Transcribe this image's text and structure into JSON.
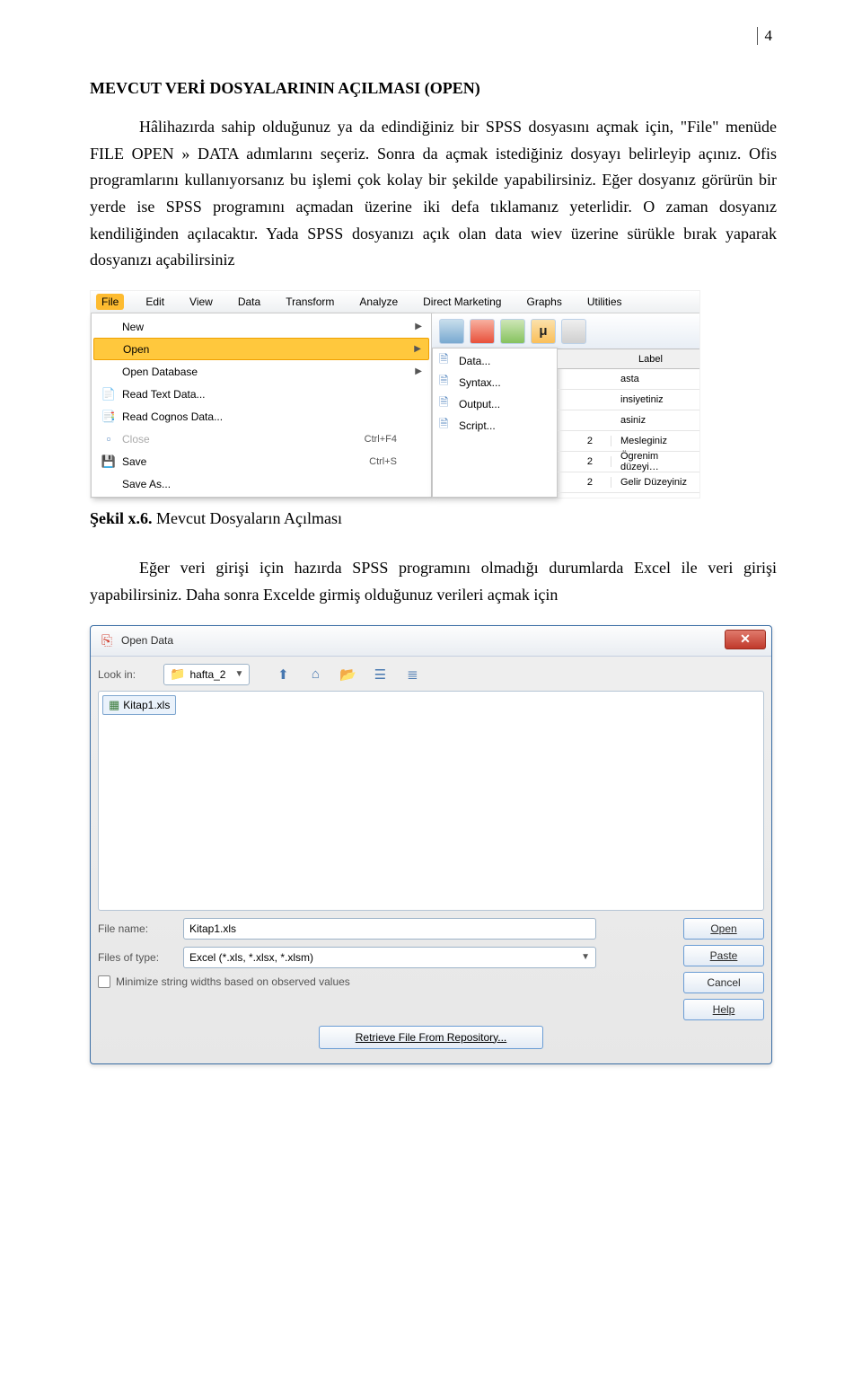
{
  "page_number": "4",
  "heading": "MEVCUT VERİ DOSYALARININ AÇILMASI (OPEN)",
  "para1": "Hâlihazırda sahip olduğunuz ya da edindiğiniz bir SPSS dosyasını açmak için, \"File\" menüde FILE OPEN » DATA adımlarını seçeriz. Sonra da açmak istediğiniz dosyayı belirleyip açınız. Ofis programlarını kullanıyorsanız bu işlemi çok kolay bir şekilde yapabilirsiniz. Eğer dosyanız görürün bir yerde ise SPSS programını açmadan üzerine iki defa tıklamanız yeterlidir. O zaman dosyanız kendiliğinden açılacaktır. Yada SPSS dosyanızı açık olan data wiev üzerine sürükle bırak yaparak dosyanızı açabilirsiniz",
  "caption": {
    "lead": "Şekil x.6.",
    "rest": " Mevcut Dosyaların Açılması"
  },
  "para2": "Eğer veri girişi için hazırda SPSS programını olmadığı durumlarda Excel ile veri girişi yapabilirsiniz. Daha sonra Excelde girmiş olduğunuz verileri açmak için",
  "spss": {
    "menubar": [
      "File",
      "Edit",
      "View",
      "Data",
      "Transform",
      "Analyze",
      "Direct Marketing",
      "Graphs",
      "Utilities"
    ],
    "file_menu": [
      {
        "label": "New",
        "arrow": true
      },
      {
        "label": "Open",
        "arrow": true,
        "highlight": true
      },
      {
        "label": "Open Database",
        "arrow": true
      },
      {
        "label": "Read Text Data...",
        "icon": "📄"
      },
      {
        "label": "Read Cognos Data...",
        "icon": "📑"
      },
      {
        "label": "Close",
        "shortcut": "Ctrl+F4",
        "disabled": true,
        "icon": "▫"
      },
      {
        "label": "Save",
        "shortcut": "Ctrl+S",
        "icon": "💾"
      },
      {
        "label": "Save As..."
      }
    ],
    "open_submenu": [
      {
        "label": "Data...",
        "icon": "🗎"
      },
      {
        "label": "Syntax...",
        "icon": "🗎"
      },
      {
        "label": "Output...",
        "icon": "🗎"
      },
      {
        "label": "Script...",
        "icon": "🗎"
      }
    ],
    "grid_header": {
      "c1": "",
      "c2": "Label"
    },
    "grid_rows": [
      {
        "c1": "",
        "c2": "asta"
      },
      {
        "c1": "",
        "c2": "insiyetiniz"
      },
      {
        "c1": "",
        "c2": "asiniz"
      },
      {
        "c1": "2",
        "c2": "Mesleginiz"
      },
      {
        "c1": "2",
        "c2": "Ögrenim düzeyi…"
      },
      {
        "c1": "2",
        "c2": "Gelir Düzeyiniz"
      }
    ]
  },
  "dialog": {
    "title": "Open Data",
    "lookin_lbl": "Look in:",
    "folder": "hafta_2",
    "file_item": "Kitap1.xls",
    "filename_lbl": "File name:",
    "filename_val": "Kitap1.xls",
    "filetype_lbl": "Files of type:",
    "filetype_val": "Excel (*.xls, *.xlsx, *.xlsm)",
    "chk_lbl": "Minimize string widths based on observed values",
    "buttons": {
      "open": "Open",
      "paste": "Paste",
      "cancel": "Cancel",
      "help": "Help"
    },
    "repo_btn": "Retrieve File From Repository..."
  }
}
